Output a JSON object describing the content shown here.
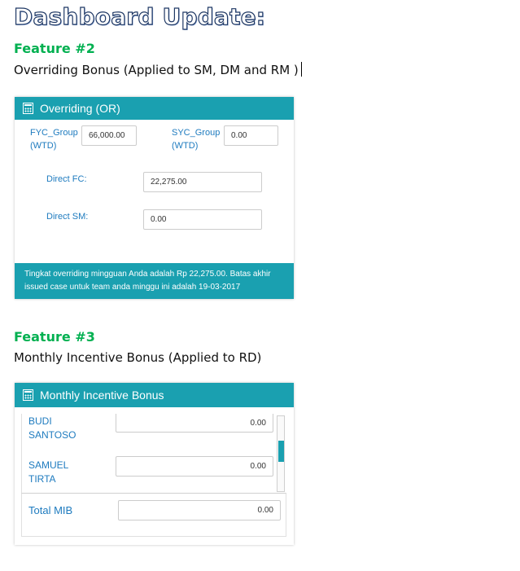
{
  "document": {
    "title": "Dashboard Update:",
    "feature2": {
      "heading": "Feature #2",
      "description": "Overriding Bonus (Applied to SM, DM and RM )"
    },
    "feature3": {
      "heading": "Feature #3",
      "description": "Monthly Incentive Bonus (Applied to RD)"
    }
  },
  "overriding_panel": {
    "title": "Overriding (OR)",
    "icon": "calculator-icon",
    "fyc_group_label_1": "FYC_Group",
    "fyc_group_label_2": "(WTD)",
    "fyc_group_value": "66,000.00",
    "syc_group_label_1": "SYC_Group",
    "syc_group_label_2": "(WTD)",
    "syc_group_value": "0.00",
    "direct_fc_label": "Direct FC:",
    "direct_fc_value": "22,275.00",
    "direct_sm_label": "Direct SM:",
    "direct_sm_value": "0.00",
    "footer_line1": "Tingkat overriding mingguan Anda adalah Rp 22,275.00. Batas akhir",
    "footer_line2": "issued case untuk team anda minggu ini adalah 19-03-2017"
  },
  "mib_panel": {
    "title": "Monthly Incentive Bonus",
    "icon": "calculator-icon",
    "rows": [
      {
        "name_line1": "BUDI",
        "name_line2": "SANTOSO",
        "value": "0.00"
      },
      {
        "name_line1": "SAMUEL",
        "name_line2": "TIRTA",
        "value": "0.00"
      }
    ],
    "total_label": "Total MIB",
    "total_value": "0.00"
  },
  "colors": {
    "header_teal": "#1aa0b0",
    "label_blue": "#1e7bbf",
    "feature_green": "#00b050"
  }
}
